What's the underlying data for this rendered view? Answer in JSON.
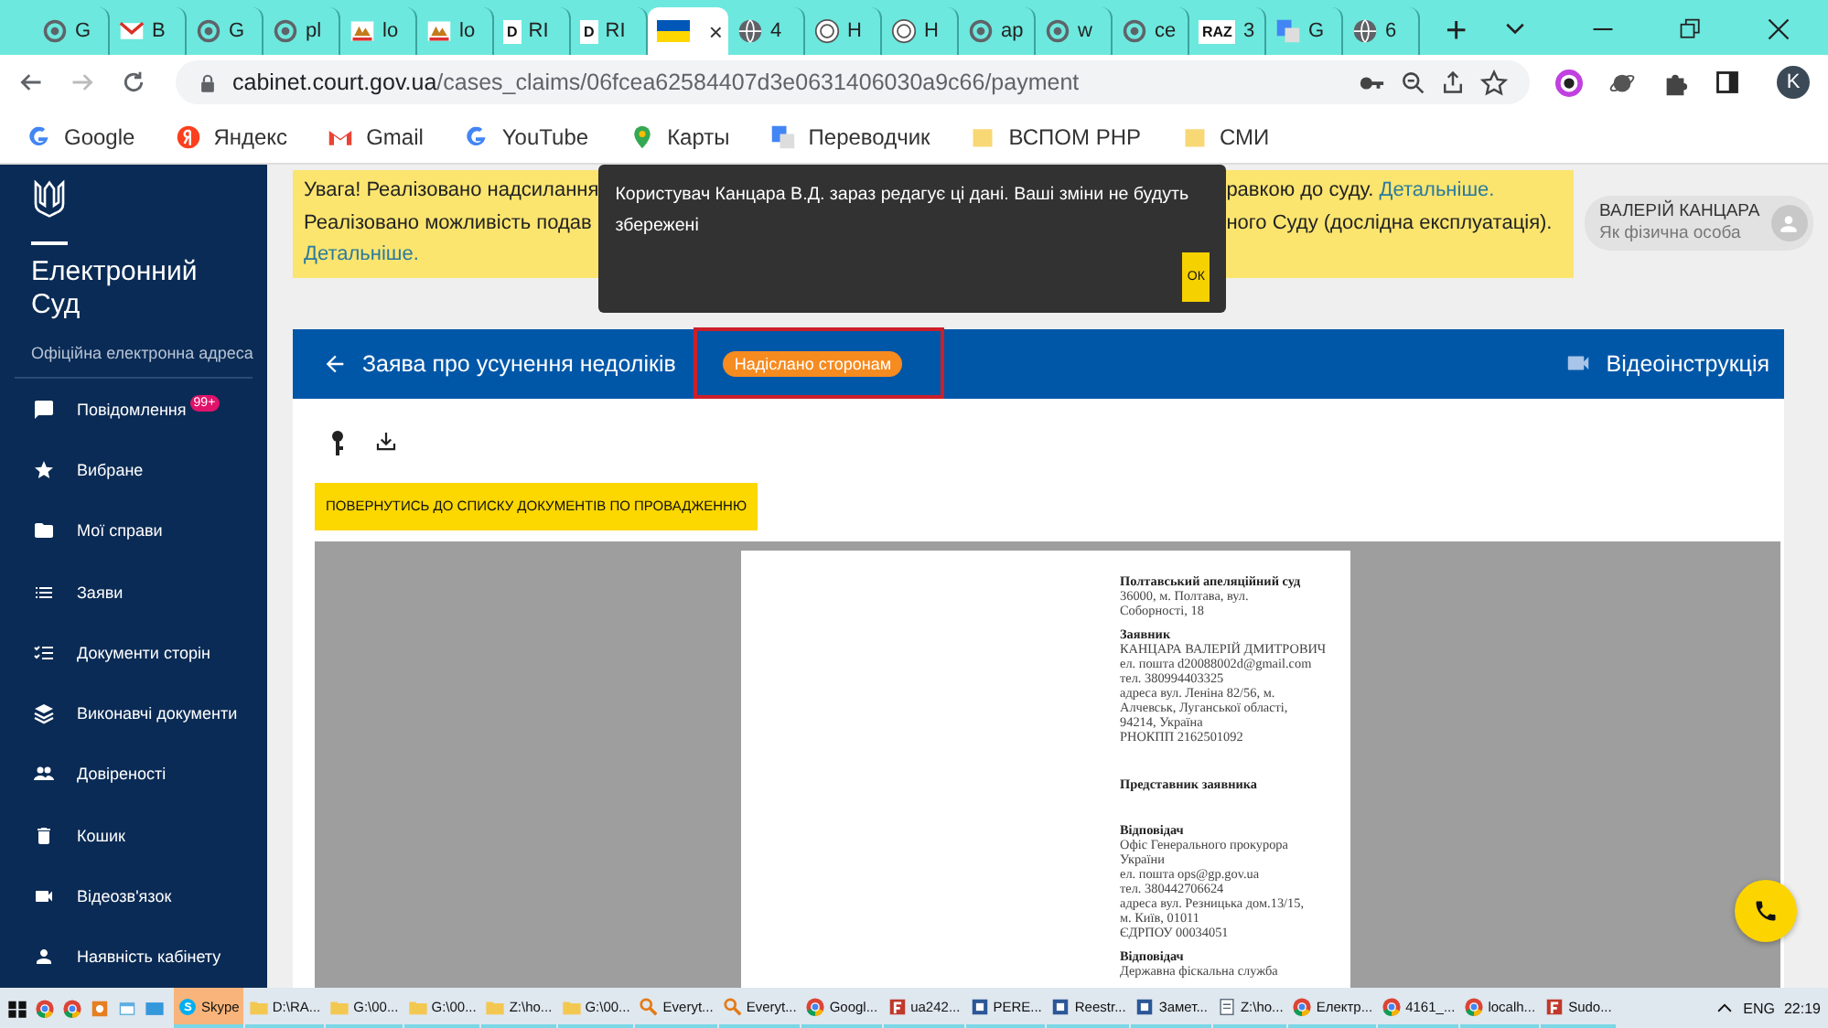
{
  "browser": {
    "tabs": [
      {
        "label": "G",
        "kind": "ring",
        "selected": false
      },
      {
        "label": "B",
        "kind": "mail",
        "selected": false
      },
      {
        "label": "G",
        "kind": "ring",
        "selected": false
      },
      {
        "label": "pl",
        "kind": "ring",
        "selected": false
      },
      {
        "label": "lo",
        "kind": "logo",
        "selected": false
      },
      {
        "label": "lo",
        "kind": "logo",
        "selected": false
      },
      {
        "label": "RI",
        "kind": "letter",
        "letter": "D",
        "selected": false
      },
      {
        "label": "RI",
        "kind": "letter",
        "letter": "D",
        "selected": false
      },
      {
        "kind": "flag",
        "close": "×",
        "selected": true
      },
      {
        "label": "4",
        "kind": "globe",
        "selected": false
      },
      {
        "label": "H",
        "kind": "seal",
        "selected": false
      },
      {
        "label": "H",
        "kind": "seal",
        "selected": false
      },
      {
        "label": "ap",
        "kind": "ring",
        "selected": false
      },
      {
        "label": "w",
        "kind": "ring",
        "selected": false
      },
      {
        "label": "ce",
        "kind": "ring",
        "selected": false
      },
      {
        "label": "3",
        "kind": "letter",
        "letter": "RAZ",
        "selected": false
      },
      {
        "label": "G",
        "kind": "translate",
        "selected": false
      },
      {
        "label": "6",
        "kind": "globe",
        "selected": false
      }
    ],
    "new_tab": "+",
    "url_host": "cabinet.court.gov.ua",
    "url_path": "/cases_claims/06fcea62584407d3e0631406030a9c66/payment",
    "profile": "K",
    "bookmarks": [
      {
        "label": "Google",
        "kind": "google"
      },
      {
        "label": "Яндекс",
        "kind": "yandex"
      },
      {
        "label": "Gmail",
        "kind": "gmail"
      },
      {
        "label": "YouTube",
        "kind": "google"
      },
      {
        "label": "Карты",
        "kind": "maps"
      },
      {
        "label": "Переводчик",
        "kind": "translate"
      },
      {
        "label": "ВСПОМ PHP",
        "kind": "folder"
      },
      {
        "label": "СМИ",
        "kind": "folder"
      }
    ]
  },
  "sidebar": {
    "title": "Електронний Суд",
    "subtitle": "Офіційна електронна адреса",
    "items": [
      {
        "label": "Повідомлення",
        "kind": "message",
        "badge": "99+"
      },
      {
        "label": "Вибране",
        "kind": "star"
      },
      {
        "label": "Мої справи",
        "kind": "folder"
      },
      {
        "label": "Заяви",
        "kind": "list"
      },
      {
        "label": "Документи сторін",
        "kind": "checklist"
      },
      {
        "label": "Виконавчі документи",
        "kind": "layers"
      },
      {
        "label": "Довіреності",
        "kind": "people"
      },
      {
        "label": "Кошик",
        "kind": "trash"
      },
      {
        "label": "Відеозв'язок",
        "kind": "video"
      },
      {
        "label": "Наявність кабінету",
        "kind": "person"
      }
    ]
  },
  "banner": {
    "lines": [
      {
        "left": "Увага! Реалізовано надсилання",
        "right": "равкою до суду.",
        "link": "Детальніше."
      },
      {
        "left": "Реалізовано можливість подав",
        "right": "ного Суду (дослідна експлуатація)."
      },
      {
        "link": "Детальніше."
      }
    ]
  },
  "toast": {
    "message": "Користувач Канцара В.Д. зараз редагує ці дані. Ваші зміни не будуть збережені",
    "button": "ОК"
  },
  "user": {
    "name": "ВАЛЕРІЙ КАНЦАРА",
    "role": "Як фізична особа"
  },
  "document": {
    "title": "Заява про усунення недоліків",
    "status": "Надіслано сторонам",
    "video_link": "Відеоінструкція",
    "back_button": "ПОВЕРНУТИСЬ ДО СПИСКУ ДОКУМЕНТІВ ПО ПРОВАДЖЕННЮ",
    "page": [
      {
        "heading": "Полтавський апеляційний суд",
        "lines": [
          "36000, м. Полтава, вул.",
          "Соборності, 18"
        ]
      },
      {
        "heading": "Заявник",
        "lines": [
          "КАНЦАРА ВАЛЕРІЙ ДМИТРОВИЧ",
          "ел. пошта d20088002d@gmail.com",
          "тел. 380994403325",
          "адреса вул. Леніна 82/56, м.",
          "Алчевськ, Луганської області,",
          "94214, Україна",
          "РНОКПП 2162501092"
        ]
      },
      {
        "heading": "Представник заявника"
      },
      {
        "heading": "Відповідач",
        "lines": [
          "Офіс Генерального прокурора",
          "України",
          "ел. пошта ops@gp.gov.ua",
          "тел. 380442706624",
          "адреса вул. Резницька дом.13/15,",
          "м. Київ, 01011",
          "ЄДРПОУ 00034051"
        ]
      },
      {
        "heading": "Відповідач",
        "lines": [
          "Державна фіскальна служба"
        ]
      }
    ]
  },
  "taskbar": {
    "items": [
      {
        "label": "Skype",
        "kind": "skype",
        "selected": true
      },
      {
        "label": "D:\\RA...",
        "kind": "folder",
        "selected": false
      },
      {
        "label": "G:\\00...",
        "kind": "folder",
        "selected": false
      },
      {
        "label": "G:\\00...",
        "kind": "folder",
        "selected": false
      },
      {
        "label": "Z:\\ho...",
        "kind": "folder",
        "selected": false
      },
      {
        "label": "G:\\00...",
        "kind": "folder",
        "selected": false
      },
      {
        "label": "Everyt...",
        "kind": "search",
        "selected": false
      },
      {
        "label": "Everyt...",
        "kind": "search",
        "selected": false
      },
      {
        "label": "Googl...",
        "kind": "chrome",
        "selected": false
      },
      {
        "label": "ua242...",
        "kind": "app",
        "selected": false
      },
      {
        "label": "PERE...",
        "kind": "doc",
        "selected": false
      },
      {
        "label": "Reestr...",
        "kind": "doc",
        "selected": false
      },
      {
        "label": "Замет...",
        "kind": "doc",
        "selected": false
      },
      {
        "label": "Z:\\ho...",
        "kind": "notepad",
        "selected": false
      },
      {
        "label": "Електр...",
        "kind": "chrome",
        "selected": false
      },
      {
        "label": "4161_...",
        "kind": "chrome",
        "selected": false
      },
      {
        "label": "localh...",
        "kind": "chrome",
        "selected": false
      },
      {
        "label": "Sudo...",
        "kind": "app",
        "selected": false
      }
    ],
    "language": "ENG",
    "time": "22:19"
  }
}
